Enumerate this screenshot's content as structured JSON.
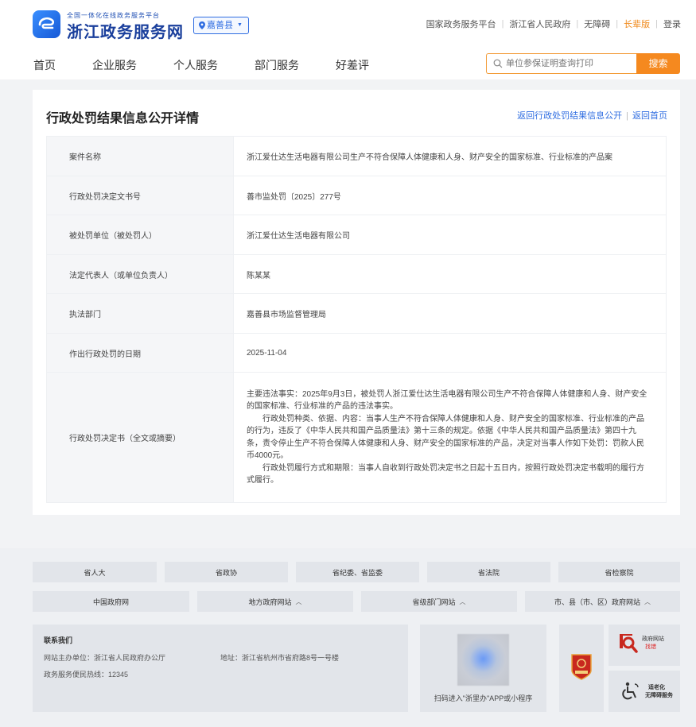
{
  "header": {
    "logo_small": "全国一体化在线政务服务平台",
    "logo_big": "浙江政务服务网",
    "region": "嘉善县",
    "top_links": [
      "国家政务服务平台",
      "浙江省人民政府",
      "无障碍",
      "长辈版",
      "登录"
    ],
    "nav": [
      "首页",
      "企业服务",
      "个人服务",
      "部门服务",
      "好差评"
    ],
    "search_placeholder": "单位参保证明查询打印",
    "search_button": "搜索",
    "accent_color": "#f5891f",
    "brand_color": "#1a3f9c"
  },
  "detail": {
    "title": "行政处罚结果信息公开详情",
    "link_back_list": "返回行政处罚结果信息公开",
    "link_home": "返回首页",
    "rows": [
      {
        "key": "案件名称",
        "value": "浙江爱仕达生活电器有限公司生产不符合保障人体健康和人身、财产安全的国家标准、行业标准的产品案"
      },
      {
        "key": "行政处罚决定文书号",
        "value": "善市监处罚〔2025〕277号"
      },
      {
        "key": "被处罚单位（被处罚人）",
        "value": "浙江爱仕达生活电器有限公司"
      },
      {
        "key": "法定代表人（或单位负责人）",
        "value": "陈某某"
      },
      {
        "key": "执法部门",
        "value": "嘉善县市场监督管理局"
      },
      {
        "key": "作出行政处罚的日期",
        "value": "2025-11-04"
      }
    ],
    "decision_key": "行政处罚决定书（全文或摘要）",
    "decision_paragraphs": [
      "主要违法事实：2025年9月3日，被处罚人浙江爱仕达生活电器有限公司生产不符合保障人体健康和人身、财产安全的国家标准、行业标准的产品的违法事实。",
      "行政处罚种类、依据、内容：当事人生产不符合保障人体健康和人身、财产安全的国家标准、行业标准的产品的行为，违反了《中华人民共和国产品质量法》第十三条的规定。依据《中华人民共和国产品质量法》第四十九条，责令停止生产不符合保障人体健康和人身、财产安全的国家标准的产品，决定对当事人作如下处罚：罚款人民币4000元。",
      "行政处罚履行方式和期限：当事人自收到行政处罚决定书之日起十五日内，按照行政处罚决定书载明的履行方式履行。"
    ]
  },
  "footer": {
    "row1": [
      "省人大",
      "省政协",
      "省纪委、省监委",
      "省法院",
      "省检察院"
    ],
    "row2": [
      "中国政府网",
      "地方政府网站",
      "省级部门网站",
      "市、县（市、区）政府网站"
    ],
    "contact_title": "联系我们",
    "contact_sponsor": "网站主办单位：浙江省人民政府办公厅",
    "contact_address": "地址：浙江省杭州市省府路8号一号楼",
    "contact_hotline": "政务服务便民热线：12345",
    "qr_caption": "扫码进入\"浙里办\"APP或小程序",
    "badge_error_line1": "政府网站",
    "badge_error_line2": "找错",
    "badge_access_line1": "适老化",
    "badge_access_line2": "无障碍服务"
  }
}
